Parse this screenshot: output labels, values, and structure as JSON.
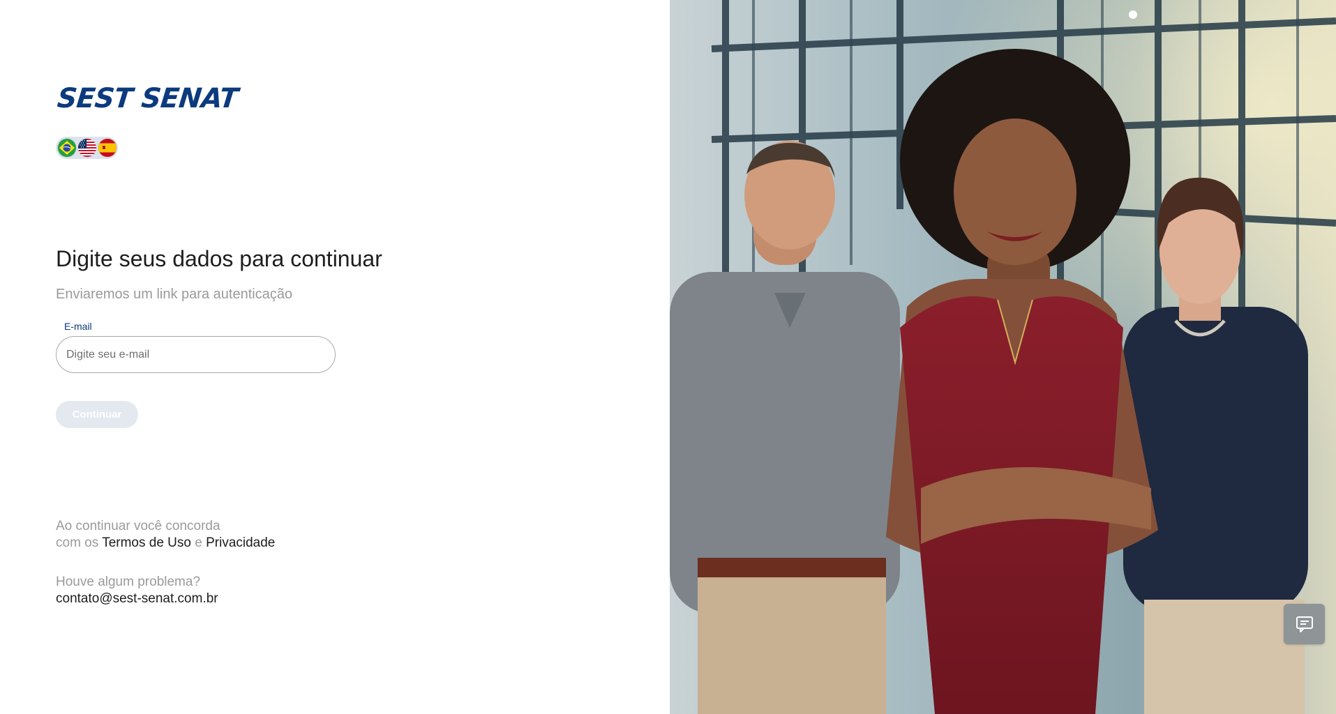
{
  "brand": {
    "logo_text": "SEST SENAT",
    "color": "#0b3a7e"
  },
  "language": {
    "options": [
      {
        "icon": "brazil-flag-icon"
      },
      {
        "icon": "usa-flag-icon"
      },
      {
        "icon": "spain-flag-icon"
      }
    ]
  },
  "form": {
    "title": "Digite seus dados para continuar",
    "subtitle": "Enviaremos um link para autenticação",
    "email_label": "E-mail",
    "email_value": "",
    "email_placeholder": "Digite seu e-mail",
    "submit_label": "Continuar"
  },
  "legal": {
    "line1": "Ao continuar você concorda",
    "line2_prefix": "com os ",
    "terms_link": "Termos de Uso",
    "conjunction": " e ",
    "privacy_link": "Privacidade"
  },
  "help": {
    "question": "Houve algum problema?",
    "contact_email": "contato@sest-senat.com.br"
  },
  "chat": {
    "icon": "chat-feedback-icon"
  },
  "hero": {
    "icon": "hero-photo"
  }
}
